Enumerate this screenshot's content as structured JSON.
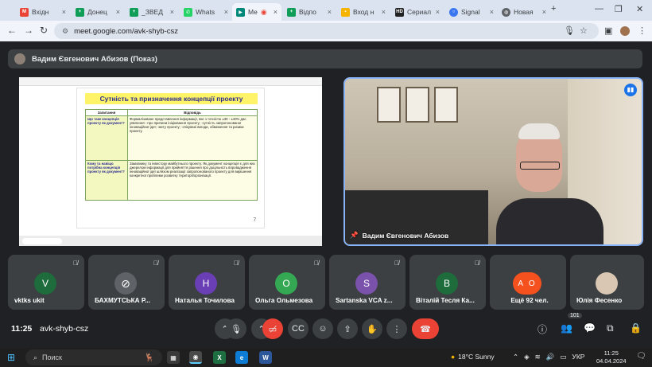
{
  "browser": {
    "tabs": [
      {
        "label": "Вхідн",
        "icon": "gmail-icon",
        "color": "#ea4335"
      },
      {
        "label": "Донец",
        "icon": "sheets-icon",
        "color": "#0f9d58"
      },
      {
        "label": "_ЗВЕД",
        "icon": "sheets-icon",
        "color": "#0f9d58"
      },
      {
        "label": "Whats",
        "icon": "whatsapp-icon",
        "color": "#25d366"
      },
      {
        "label": "Me",
        "icon": "meet-icon",
        "color": "#00897b"
      },
      {
        "label": "Відпо",
        "icon": "sheets-icon",
        "color": "#0f9d58"
      },
      {
        "label": "Вход н",
        "icon": "folder-icon",
        "color": "#f4b400"
      },
      {
        "label": "Сериал",
        "icon": "hd-icon",
        "color": "#222222"
      },
      {
        "label": "Signal",
        "icon": "signal-icon",
        "color": "#3a76f0"
      },
      {
        "label": "Новая",
        "icon": "globe-icon",
        "color": "#5f6368"
      }
    ],
    "url": "meet.google.com/avk-shyb-csz"
  },
  "meet": {
    "presenter_bar": "Вадим Євгенович Абизов (Показ)",
    "slide": {
      "title": "Сутність та призначення концепції проекту",
      "headers": [
        "Запитання",
        "Відповідь"
      ],
      "rows": [
        {
          "q": "Що таке концепція проекту як документ?",
          "a": "Формалізоване представлення інформації, яке з точністю ±30 - ±40% дає уявлення: -про причини ініціювання проекту; -сутність запропонованої інноваційної ідеї; -мету проекту; -очікувані вигоди, обмеження та ризики проекту."
        },
        {
          "q": "Кому та навіщо потрібна концепція проекту як документ?",
          "a": "Замовнику та інвестору майбутнього проекту. Як документ концепція є для них джерелом інформації для прийняття рішення про доцільність впровадження інноваційної ідеї шляхом реалізації запропонованого проекту для вирішення конкретної проблеми розвитку території/організації."
        }
      ],
      "page": "7"
    },
    "speaker_name": "Вадим Євгенович Абизов",
    "participants": [
      {
        "initial": "V",
        "name": "vktks ukit",
        "color": "#1e6b3c"
      },
      {
        "initial": "",
        "name": "БАХМУТСЬКА Р...",
        "color": "#5f6368"
      },
      {
        "initial": "Н",
        "name": "Наталья Точилова",
        "color": "#6a3fb5"
      },
      {
        "initial": "О",
        "name": "Ольга Ольмезова",
        "color": "#34a853"
      },
      {
        "initial": "S",
        "name": "Sartanska VCA z...",
        "color": "#7b52ab"
      },
      {
        "initial": "В",
        "name": "Віталій Тесля Ка...",
        "color": "#1e6b3c"
      },
      {
        "initial": "А О",
        "name": "Ещё 92 чел.",
        "color": "#f4511e"
      },
      {
        "initial": "",
        "name": "Юлія Фесенко",
        "color": "#d9c7b4"
      }
    ],
    "time": "11:25",
    "meeting_code": "avk-shyb-csz",
    "participant_count": "101"
  },
  "taskbar": {
    "search_placeholder": "Поиск",
    "weather": "18°C  Sunny",
    "lang": "УКР",
    "time": "11:25",
    "date": "04.04.2024"
  }
}
